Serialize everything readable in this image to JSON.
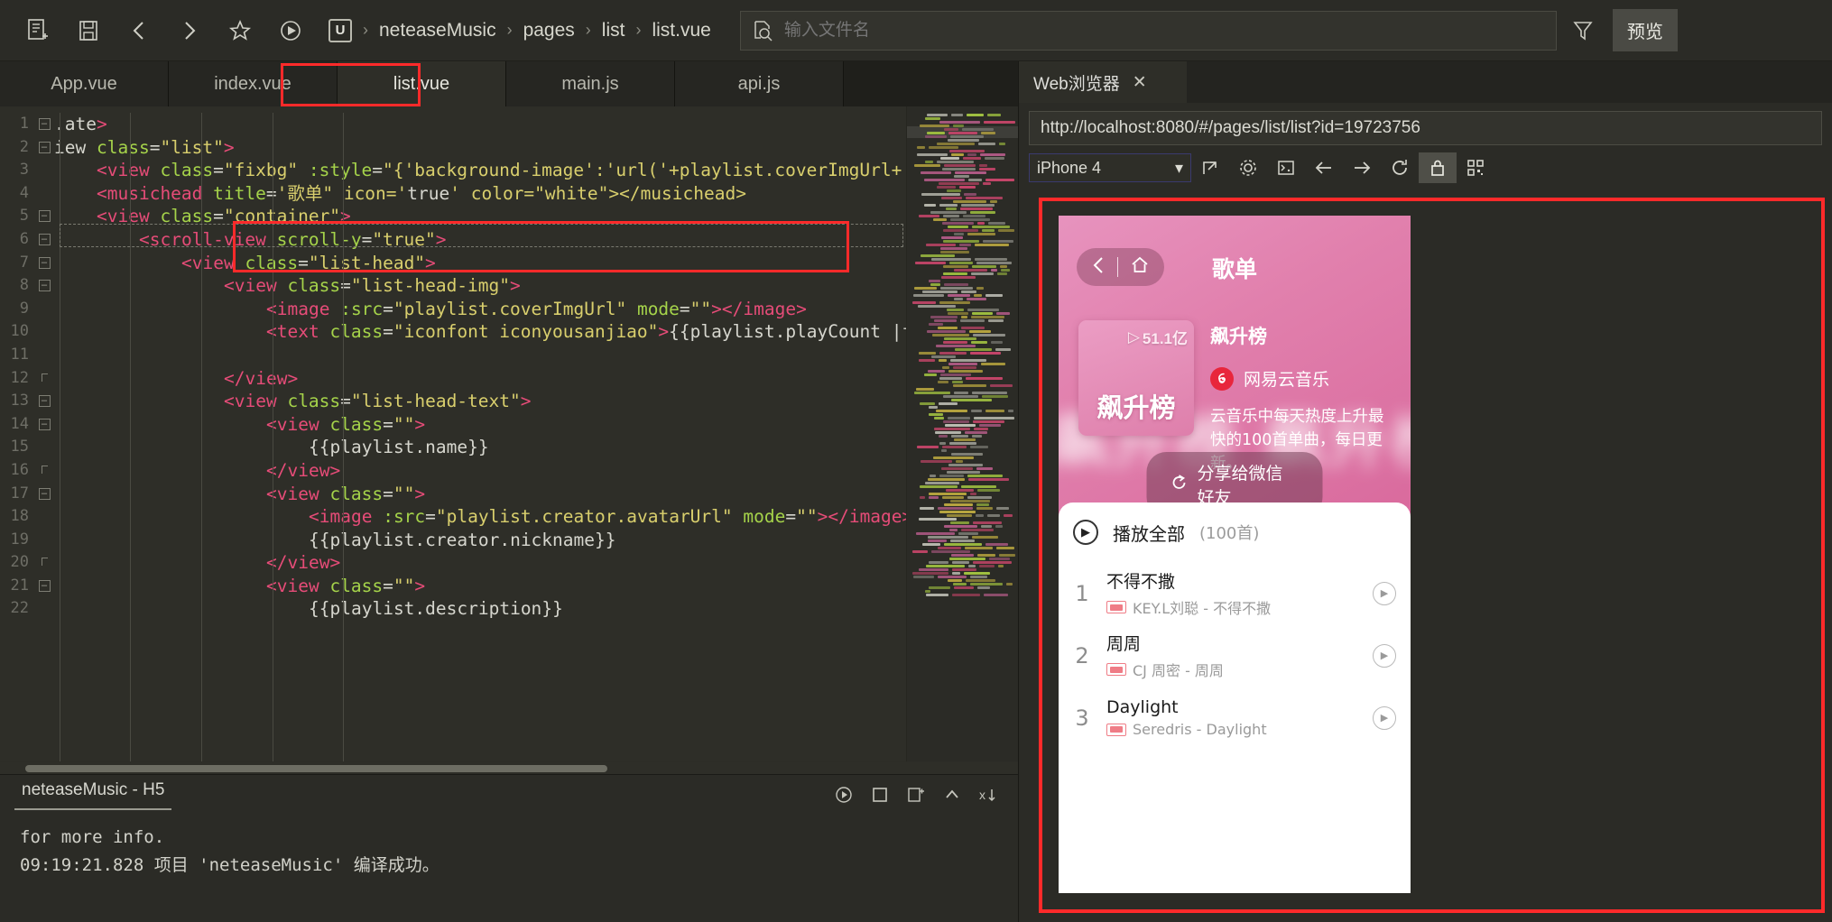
{
  "toolbar": {
    "icons": [
      "new-file-icon",
      "save-icon",
      "back-arrow-icon",
      "forward-arrow-icon",
      "star-icon",
      "run-icon"
    ],
    "project_badge": "U",
    "breadcrumb": [
      "neteaseMusic",
      "pages",
      "list",
      "list.vue"
    ],
    "search_placeholder": "输入文件名",
    "search_value": "",
    "filter_icon": "filter-icon",
    "preview_label": "预览"
  },
  "editor": {
    "tabs": [
      {
        "label": "App.vue",
        "active": false
      },
      {
        "label": "index.vue",
        "active": false
      },
      {
        "label": "list.vue",
        "active": true
      },
      {
        "label": "main.js",
        "active": false
      },
      {
        "label": "api.js",
        "active": false
      }
    ],
    "lines": [
      {
        "n": "1",
        "fold": "-",
        "text": ".ate>"
      },
      {
        "n": "2",
        "fold": "-",
        "text": "iew class=\"list\">"
      },
      {
        "n": "3",
        "fold": "",
        "text": "    <view class=\"fixbg\" :style=\"{'background-image':'url('+playlist.coverImgUrl+')'}\"></view>"
      },
      {
        "n": "4",
        "fold": "",
        "text": "    <musichead title='歌单\" icon='true' color=\"white\"></musichead>"
      },
      {
        "n": "5",
        "fold": "-",
        "text": "    <view class=\"container\">"
      },
      {
        "n": "6",
        "fold": "-",
        "text": "        <scroll-view scroll-y=\"true\">"
      },
      {
        "n": "7",
        "fold": "-",
        "text": "            <view class=\"list-head\">"
      },
      {
        "n": "8",
        "fold": "-",
        "text": "                <view class=\"list-head-img\">"
      },
      {
        "n": "9",
        "fold": "",
        "text": "                    <image :src=\"playlist.coverImgUrl\" mode=\"\"></image>"
      },
      {
        "n": "10",
        "fold": "",
        "text": "                    <text class=\"iconfont iconyousanjiao\">{{playlist.playCount |formatCount}}"
      },
      {
        "n": "11",
        "fold": "",
        "text": ""
      },
      {
        "n": "12",
        "fold": "|",
        "text": "                </view>"
      },
      {
        "n": "13",
        "fold": "-",
        "text": "                <view class=\"list-head-text\">"
      },
      {
        "n": "14",
        "fold": "-",
        "text": "                    <view class=\"\">"
      },
      {
        "n": "15",
        "fold": "",
        "text": "                        {{playlist.name}}"
      },
      {
        "n": "16",
        "fold": "|",
        "text": "                    </view>"
      },
      {
        "n": "17",
        "fold": "-",
        "text": "                    <view class=\"\">"
      },
      {
        "n": "18",
        "fold": "",
        "text": "                        <image :src=\"playlist.creator.avatarUrl\" mode=\"\"></image>"
      },
      {
        "n": "19",
        "fold": "",
        "text": "                        {{playlist.creator.nickname}}"
      },
      {
        "n": "20",
        "fold": "|",
        "text": "                    </view>"
      },
      {
        "n": "21",
        "fold": "-",
        "text": "                    <view class=\"\">"
      },
      {
        "n": "22",
        "fold": "",
        "text": "                        {{playlist.description}}"
      }
    ]
  },
  "console": {
    "tab_label": "neteaseMusic - H5",
    "tool_icons": [
      "run-icon",
      "stop-icon",
      "clear-icon",
      "collapse-icon",
      "sort-icon"
    ],
    "lines": [
      "  for more info.",
      "09:19:21.828 项目 'neteaseMusic' 编译成功。"
    ]
  },
  "browser": {
    "tab_label": "Web浏览器",
    "close_icon": "close-icon",
    "url": "http://localhost:8080/#/pages/list/list?id=19723756",
    "device": "iPhone 4",
    "dev_icons": [
      "popout-icon",
      "gear-icon",
      "console-icon",
      "back-arrow-icon",
      "forward-arrow-icon",
      "reload-icon",
      "lock-icon",
      "grid-icon"
    ],
    "highlight_color": "#ff2a2a"
  },
  "phone": {
    "nav": {
      "back_icon": "chevron-left-icon",
      "home_icon": "home-icon"
    },
    "title": "歌单",
    "cover": {
      "play_count": "51.1亿",
      "play_icon": "triangle-play-icon",
      "name": "飙升榜"
    },
    "playlist_name": "飙升榜",
    "creator": {
      "nickname": "网易云音乐",
      "avatar_icon": "netease-logo-icon"
    },
    "description": "云音乐中每天热度上升最快的100首单曲，每日更新。",
    "blurred_text": "飙升榜 飙升榜",
    "share_label": "分享给微信好友",
    "share_icon": "share-icon",
    "play_all": {
      "label": "播放全部",
      "count": "(100首)",
      "icon": "play-circle-icon"
    },
    "songs": [
      {
        "index": "1",
        "name": "不得不撒",
        "artist": "KEY.L刘聪 - 不得不撒",
        "badge": "sq-badge"
      },
      {
        "index": "2",
        "name": "周周",
        "artist": "CJ 周密 - 周周",
        "badge": "sq-badge"
      },
      {
        "index": "3",
        "name": "Daylight",
        "artist": "Seredris - Daylight",
        "badge": "sq-badge"
      }
    ]
  }
}
